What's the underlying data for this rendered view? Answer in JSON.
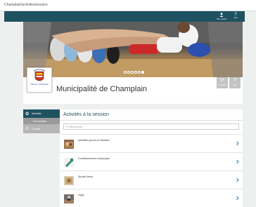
{
  "url": "Champlain/activites/session",
  "topbar": {
    "account_label": "Mon compte",
    "help_label": "Aide"
  },
  "banner": {
    "slide_count": 6,
    "active_slide": 5
  },
  "header": {
    "logo_text": "Ville de Champlain",
    "title": "Municipalité de Champlain",
    "actions": [
      {
        "label": "Actualiser"
      },
      {
        "label": "Aide"
      }
    ]
  },
  "sidebar": {
    "items": [
      {
        "label": "Activités",
        "icon": "star-icon"
      },
      {
        "label": "À la session"
      },
      {
        "label": "Contact",
        "icon": "phone-icon"
      }
    ]
  },
  "main": {
    "title": "Activités à la session",
    "search_placeholder": "Recherche",
    "items": [
      {
        "label": "Activités jeunes et familles"
      },
      {
        "label": "Conditionnement physique"
      },
      {
        "label": "Sports libres"
      },
      {
        "label": "Yoga"
      }
    ]
  },
  "colors": {
    "primary": "#1f5260",
    "chevron": "#1f6aa0"
  }
}
